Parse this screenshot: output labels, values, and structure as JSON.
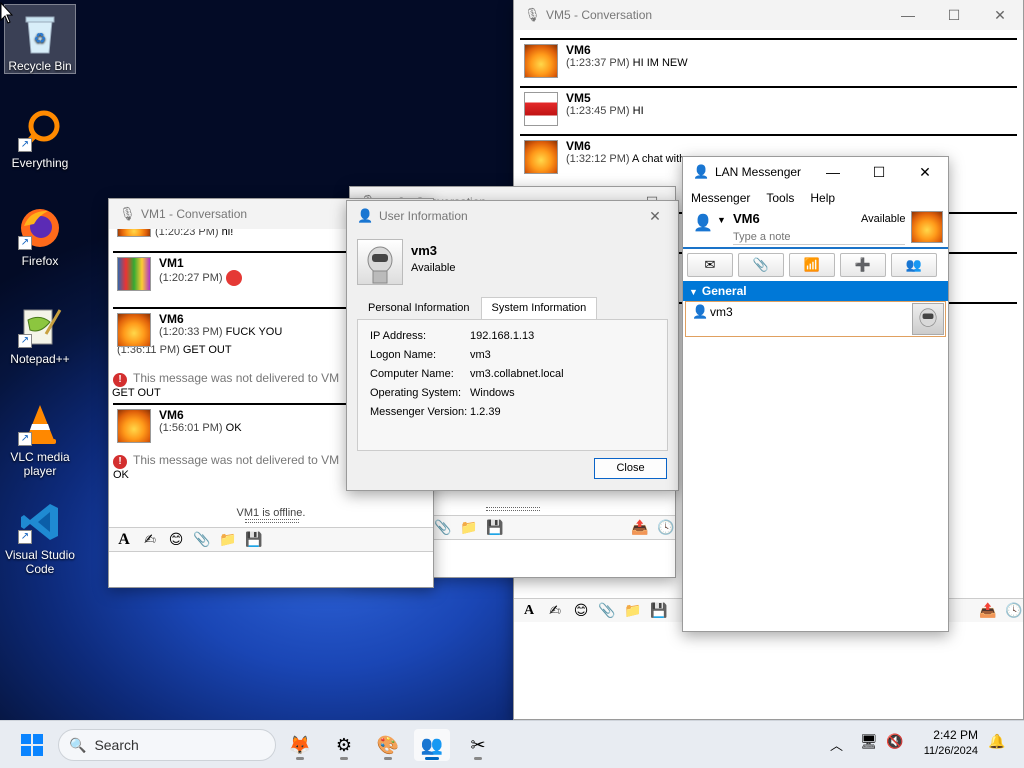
{
  "desktop": {
    "icons": [
      {
        "label": "Recycle Bin",
        "icon": "recycle-bin-icon"
      },
      {
        "label": "Everything",
        "icon": "everything-search-icon"
      },
      {
        "label": "Firefox",
        "icon": "firefox-icon"
      },
      {
        "label": "Notepad++",
        "icon": "notepad-plus-plus-icon"
      },
      {
        "label": "VLC media player",
        "icon": "vlc-icon"
      },
      {
        "label": "Visual Studio Code",
        "icon": "vscode-icon"
      }
    ]
  },
  "vm5_conv": {
    "title": "VM5 - Conversation",
    "messages": [
      {
        "name": "VM6",
        "time": "(1:23:37 PM)",
        "text": "HI IM NEW"
      },
      {
        "name": "VM5",
        "time": "(1:23:45 PM)",
        "text": "HI"
      },
      {
        "name": "VM6",
        "time": "(1:32:12 PM)",
        "text": "A chat with"
      }
    ]
  },
  "vm1_conv": {
    "title": "VM1 - Conversation",
    "top_time": "(1:20:23 PM)",
    "top_text": "hi!",
    "messages": [
      {
        "name": "VM1",
        "time": "(1:20:27 PM)",
        "text": ""
      },
      {
        "name": "VM6",
        "time": "(1:20:33 PM)",
        "text": "FUCK YOU",
        "time2": "(1:36:11 PM)",
        "text2": "GET OUT"
      },
      {
        "name": "VM6",
        "time": "(1:56:01 PM)",
        "text": "OK"
      }
    ],
    "warning1": "This message was not delivered to VM",
    "warning1_text": "GET OUT",
    "warning2": "This message was not delivered to VM",
    "warning2_text": "OK",
    "status": "VM1 is offline."
  },
  "vm3_conv": {
    "title": "vm3 - Conversation"
  },
  "user_info": {
    "title": "User Information",
    "name": "vm3",
    "status": "Available",
    "tabs": [
      "Personal Information",
      "System Information"
    ],
    "active_tab": "System Information",
    "fields": [
      {
        "label": "IP Address:",
        "value": "192.168.1.13"
      },
      {
        "label": "Logon Name:",
        "value": "vm3"
      },
      {
        "label": "Computer Name:",
        "value": "vm3.collabnet.local"
      },
      {
        "label": "Operating System:",
        "value": "Windows"
      },
      {
        "label": "Messenger Version:",
        "value": "1.2.39"
      }
    ],
    "close_label": "Close"
  },
  "lan_messenger": {
    "title": "LAN Messenger",
    "menu": [
      "Messenger",
      "Tools",
      "Help"
    ],
    "user": "VM6",
    "status": "Available",
    "note_placeholder": "Type a note",
    "group": "General",
    "contacts": [
      {
        "name": "vm3"
      }
    ]
  },
  "taskbar": {
    "search_label": "Search",
    "time": "2:42 PM",
    "date": "11/26/2024"
  },
  "colors": {
    "accent": "#0078d7",
    "group_bar": "#0078d7"
  }
}
